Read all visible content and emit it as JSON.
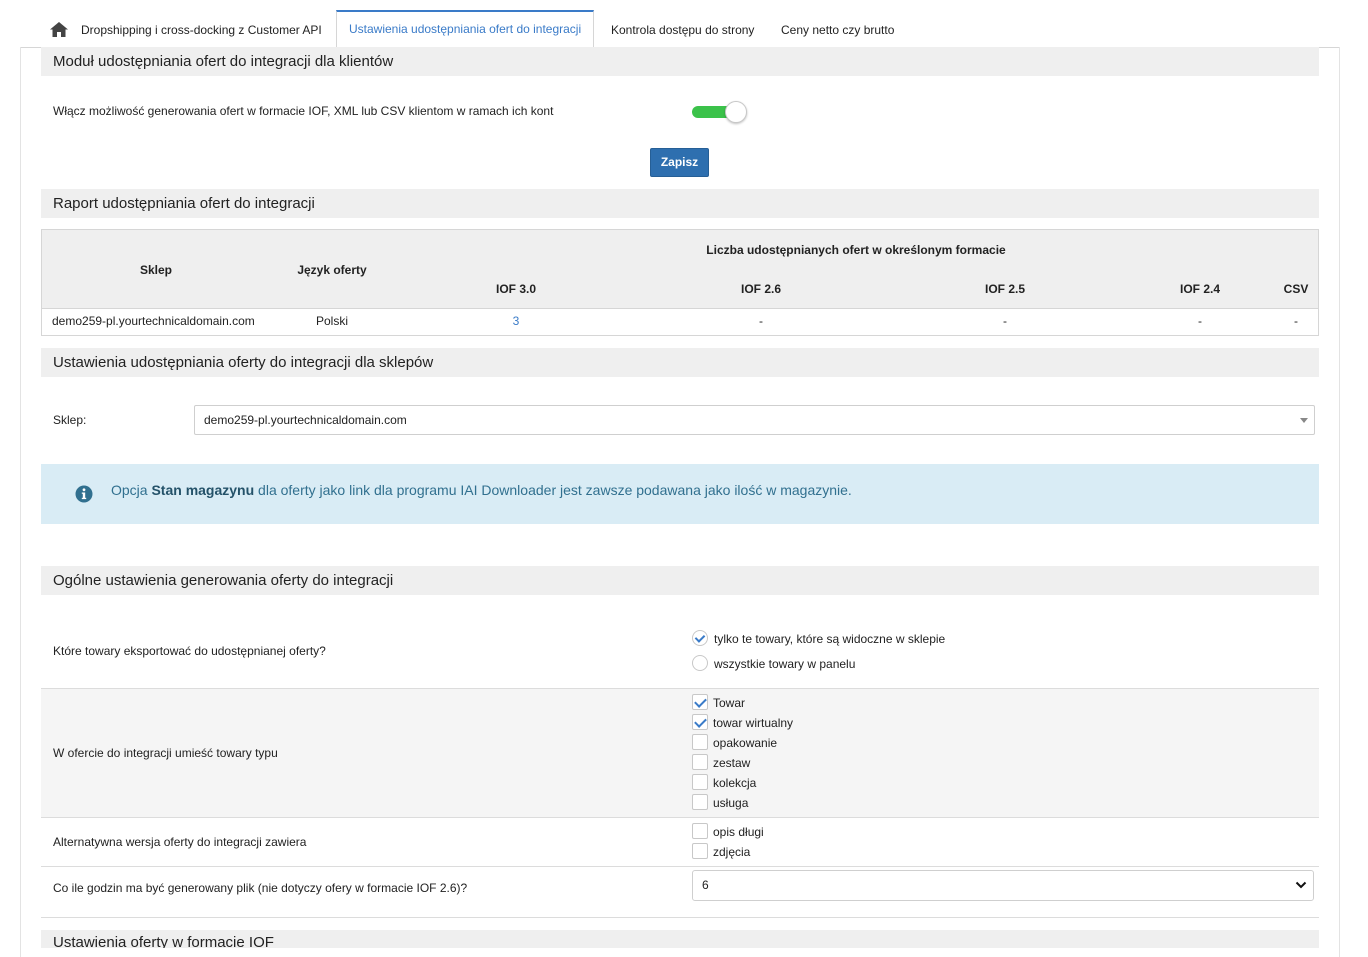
{
  "tabs": [
    {
      "label": "Dropshipping i cross-docking z Customer API"
    },
    {
      "label": "Ustawienia udostępniania ofert do integracji"
    },
    {
      "label": "Kontrola dostępu do strony"
    },
    {
      "label": "Ceny netto czy brutto"
    }
  ],
  "colors": {
    "accent": "#3a7bc8",
    "toggle_on": "#3bc24a",
    "button": "#2e6faf",
    "info_bg": "#d9ecf5"
  },
  "module": {
    "title": "Moduł udostępniania ofert do integracji dla klientów",
    "toggle_label": "Włącz możliwość generowania ofert w formacie IOF, XML lub CSV klientom w ramach ich kont",
    "toggle_on": true,
    "save_label": "Zapisz"
  },
  "report": {
    "title": "Raport udostępniania ofert do integracji",
    "col_shop": "Sklep",
    "col_lang": "Język oferty",
    "group_header": "Liczba udostępnianych ofert w określonym formacie",
    "formats": [
      "IOF 3.0",
      "IOF 2.6",
      "IOF 2.5",
      "IOF 2.4",
      "CSV"
    ],
    "rows": [
      {
        "shop": "demo259-pl.yourtechnicaldomain.com",
        "lang": "Polski",
        "values": [
          "3",
          "-",
          "-",
          "-",
          "-"
        ]
      }
    ]
  },
  "shop_settings": {
    "title": "Ustawienia udostępniania oferty do integracji dla sklepów",
    "shop_label": "Sklep:",
    "shop_value": "demo259-pl.yourtechnicaldomain.com"
  },
  "info": {
    "pre": "Opcja ",
    "bold": "Stan magazynu",
    "post": " dla oferty jako link dla programu IAI Downloader jest zawsze podawana jako ilość w magazynie."
  },
  "general": {
    "title": "Ogólne ustawienia generowania oferty do integracji",
    "export_question": "Które towary eksportować do udostępnianej oferty?",
    "export_options": [
      {
        "label": "tylko te towary, które są widoczne w sklepie",
        "checked": true
      },
      {
        "label": "wszystkie towary w panelu",
        "checked": false
      }
    ],
    "types_label": "W ofercie do integracji umieść towary typu",
    "types": [
      {
        "label": "Towar",
        "checked": true
      },
      {
        "label": "towar wirtualny",
        "checked": true
      },
      {
        "label": "opakowanie",
        "checked": false
      },
      {
        "label": "zestaw",
        "checked": false
      },
      {
        "label": "kolekcja",
        "checked": false
      },
      {
        "label": "usługa",
        "checked": false
      }
    ],
    "alt_label": "Alternatywna wersja oferty do integracji zawiera",
    "alt_options": [
      {
        "label": "opis długi",
        "checked": false
      },
      {
        "label": "zdjęcia",
        "checked": false
      }
    ],
    "hours_label": "Co ile godzin ma być generowany plik (nie dotyczy ofery w formacie IOF 2.6)?",
    "hours_value": "6"
  },
  "iof": {
    "title": "Ustawienia oferty w formacie IOF"
  }
}
